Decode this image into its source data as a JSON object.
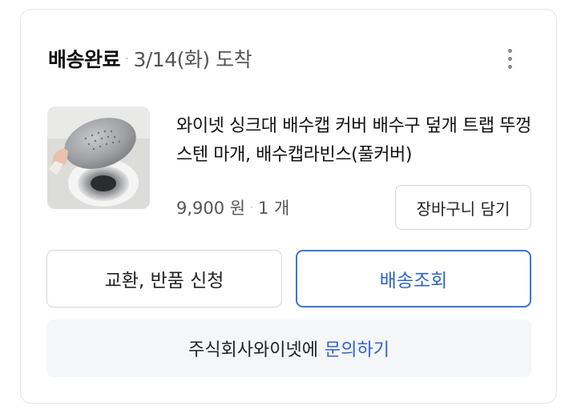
{
  "header": {
    "status": "배송완료",
    "separator": "·",
    "arrival": "3/14(화) 도착",
    "more_icon": "more-vertical-icon"
  },
  "product": {
    "image": "sink-drain-cover-photo",
    "title": "와이넷 싱크대 배수캡 커버 배수구 덮개 트랩 뚜껑 스텐 마개, 배수캡라빈스(풀커버)",
    "price": "9,900 원",
    "separator": "·",
    "quantity": "1 개",
    "cart_button": "장바구니 담기"
  },
  "actions": {
    "exchange_label": "교환, 반품 신청",
    "track_label": "배송조회"
  },
  "inquiry": {
    "seller": "주식회사와이넷에",
    "link_label": "문의하기"
  },
  "colors": {
    "accent": "#2f62cf",
    "border": "#d6d6d6",
    "inquiry_bg": "#f5f6f8"
  }
}
